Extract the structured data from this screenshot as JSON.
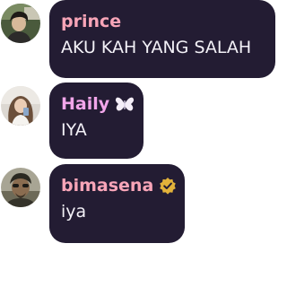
{
  "messages": [
    {
      "author": "prince",
      "author_color": "#f8a5b8",
      "badge_icon": "",
      "avatar_icon": "user-avatar-prince",
      "text": "AKU KAH YANG SALAH"
    },
    {
      "author": "Haily",
      "author_color": "#f2a6ea",
      "badge_icon": "butterfly-icon",
      "avatar_icon": "user-avatar-haily",
      "text": "IYA"
    },
    {
      "author": "bimasena",
      "author_color": "#f8a5b8",
      "badge_icon": "verified-badge-icon",
      "avatar_icon": "user-avatar-bimasena",
      "text": "iya"
    }
  ],
  "colors": {
    "bubble_background": "#231c33",
    "message_text": "#f3f1f7",
    "verified_badge": "#e2b23a"
  }
}
